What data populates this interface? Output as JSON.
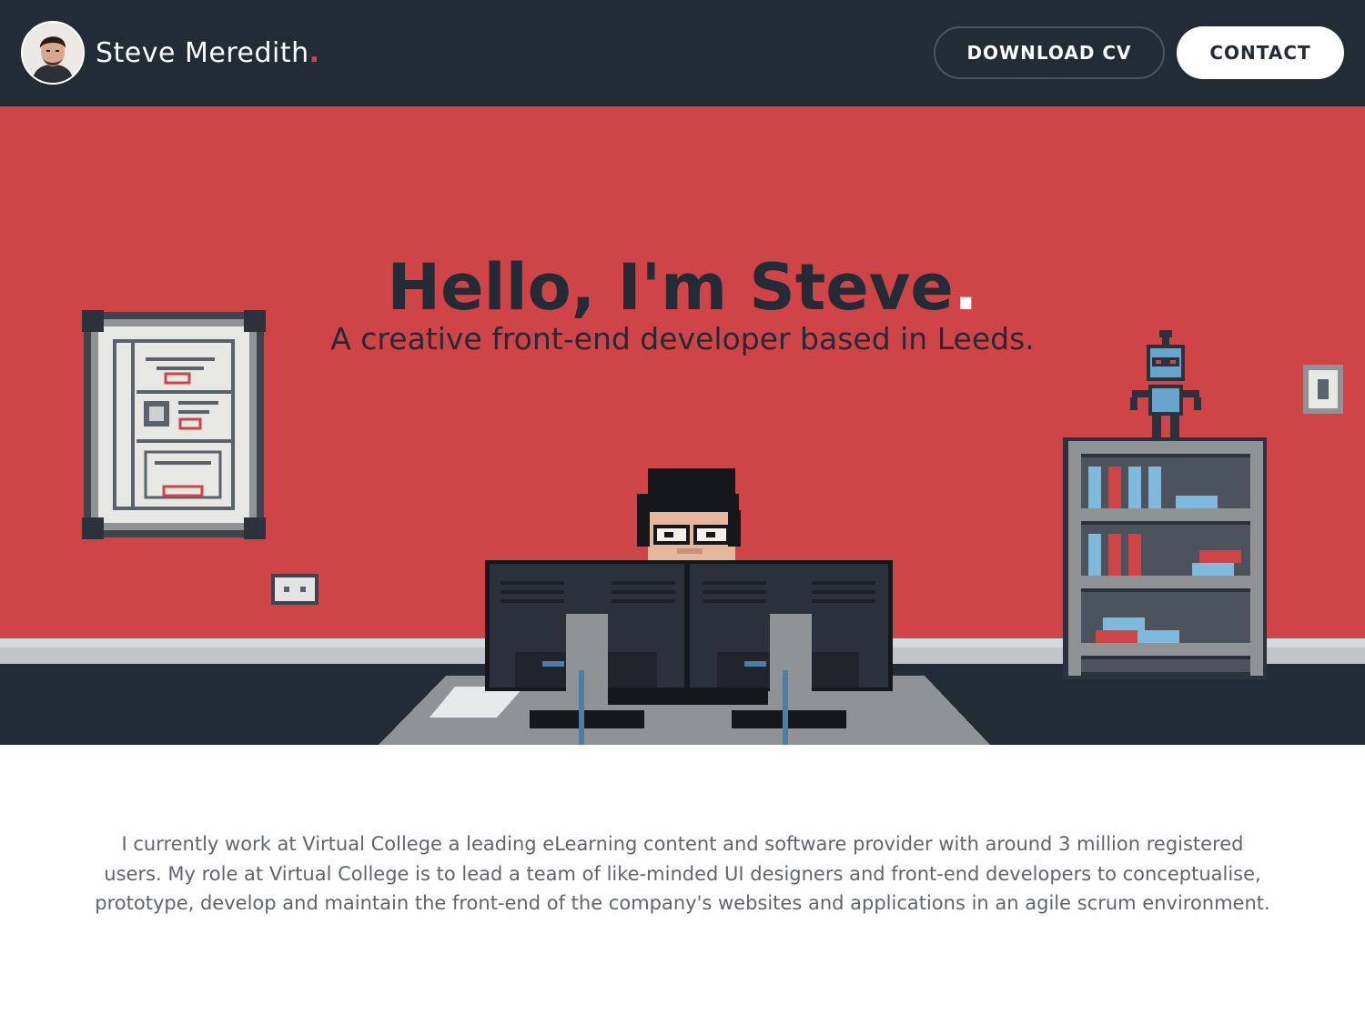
{
  "header": {
    "name": "Steve Meredith",
    "name_dot": ".",
    "download_cv_label": "DOWNLOAD CV",
    "contact_label": "CONTACT"
  },
  "hero": {
    "title": "Hello, I'm Steve",
    "title_dot": ".",
    "subtitle": "A creative front-end developer based in Leeds."
  },
  "intro": {
    "text": "I currently work at Virtual College a leading eLearning content and software provider with around 3 million registered users. My role at Virtual College is to lead a team of like-minded UI designers and front-end developers to conceptualise, prototype, develop and maintain the front-end of the company's websites and applications in an agile scrum environment."
  },
  "colors": {
    "header_bg": "#232b36",
    "hero_bg": "#cf4446",
    "accent": "#cf4446",
    "text_dark": "#232b36",
    "body_text": "#5d6670"
  }
}
